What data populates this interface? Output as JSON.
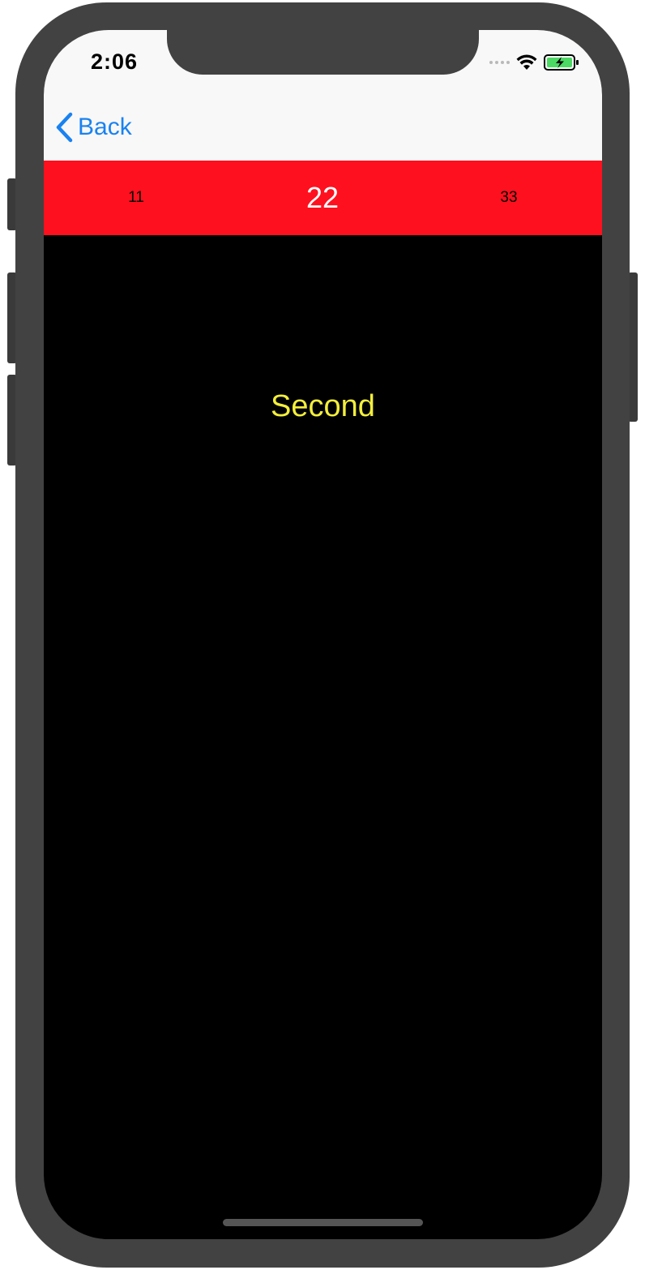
{
  "status_bar": {
    "time": "2:06",
    "icons": [
      "signal-dots-icon",
      "wifi-icon",
      "battery-charging-icon"
    ]
  },
  "navigation": {
    "back_label": "Back",
    "back_icon": "chevron-left-icon"
  },
  "tabs": [
    {
      "label": "11",
      "selected": false
    },
    {
      "label": "22",
      "selected": true
    },
    {
      "label": "33",
      "selected": false
    }
  ],
  "content": {
    "label": "Second"
  },
  "colors": {
    "tab_bar_background": "#ff101e",
    "nav_tint": "#1a82f0",
    "content_background": "#000000",
    "content_text": "#f2ee3c",
    "selected_tab_text": "#ffffff",
    "unselected_tab_text": "#000000",
    "battery_fill": "#4cd964"
  }
}
